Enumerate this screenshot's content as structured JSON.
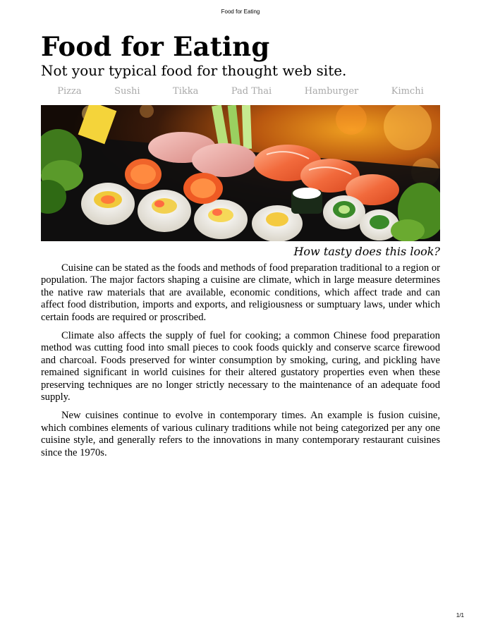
{
  "header": {
    "running_title": "Food for Eating"
  },
  "site": {
    "title": "Food for Eating",
    "tagline": "Not your typical food for thought web site."
  },
  "nav": {
    "items": [
      {
        "label": "Pizza"
      },
      {
        "label": "Sushi"
      },
      {
        "label": "Tikka"
      },
      {
        "label": "Pad Thai"
      },
      {
        "label": "Hamburger"
      },
      {
        "label": "Kimchi"
      }
    ]
  },
  "hero": {
    "caption": "How tasty does this look?"
  },
  "article": {
    "paragraphs": [
      "Cuisine can be stated as the foods and methods of food preparation traditional to a region or population. The major factors shaping a cuisine are climate, which in large measure determines the native raw materials that are available, economic conditions, which affect trade and can affect food distribution, imports and exports, and religiousness or sumptuary laws, under which certain foods are required or proscribed.",
      "Climate also affects the supply of fuel for cooking; a common Chinese food preparation method was cutting food into small pieces to cook foods quickly and conserve scarce firewood and charcoal. Foods preserved for winter consumption by smoking, curing, and pickling have remained significant in world cuisines for their altered gustatory properties even when these preserving techniques are no longer strictly necessary to the maintenance of an adequate food supply.",
      "New cuisines continue to evolve in contemporary times. An example is fusion cuisine, which combines elements of various culinary traditions while not being categorized per any one cuisine style, and generally refers to the innovations in many contemporary restaurant cuisines since the 1970s."
    ]
  },
  "footer": {
    "page_number": "1/1"
  },
  "colors": {
    "text": "#000000",
    "nav_text": "#a8a8a8",
    "background": "#ffffff"
  }
}
